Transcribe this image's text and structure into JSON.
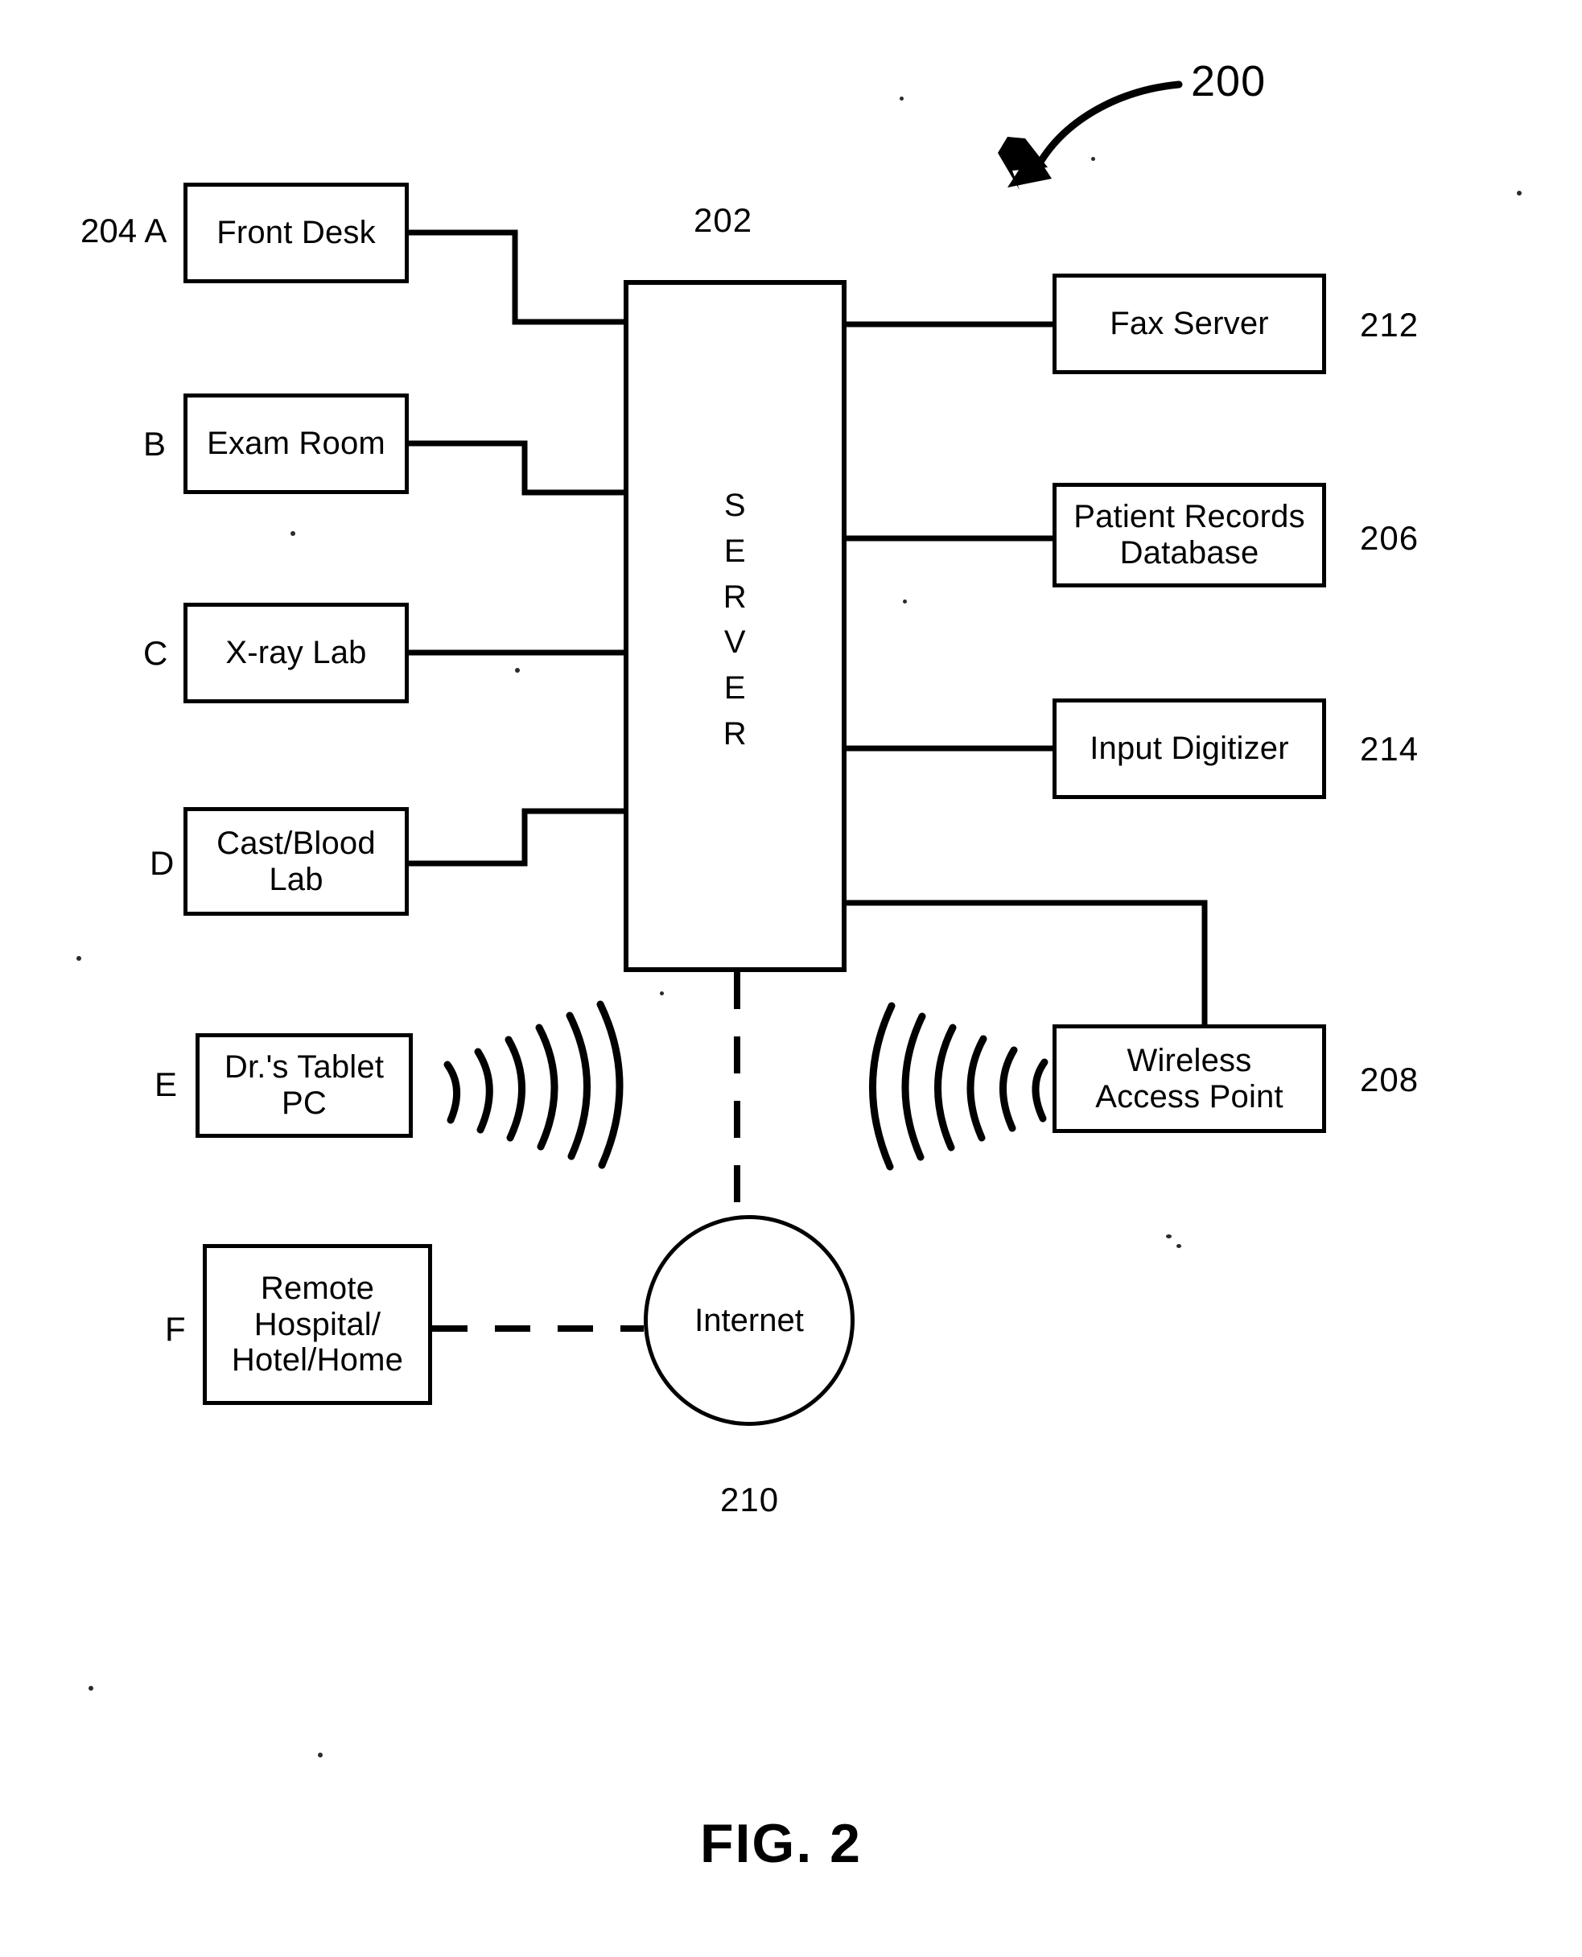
{
  "figure": {
    "caption": "FIG. 2",
    "system_ref": "200",
    "server_ref": "202",
    "server_label_letters": [
      "S",
      "E",
      "R",
      "V",
      "E",
      "R"
    ],
    "server_label_text": "SERVER"
  },
  "client_nodes": [
    {
      "letter": "204 A",
      "label": "Front Desk"
    },
    {
      "letter": "B",
      "label": "Exam Room"
    },
    {
      "letter": "C",
      "label": "X-ray Lab"
    },
    {
      "letter": "D",
      "label": "Cast/Blood\nLab",
      "line1": "Cast/Blood",
      "line2": "Lab"
    },
    {
      "letter": "E",
      "label": "Dr.'s Tablet\nPC",
      "line1": "Dr.'s Tablet",
      "line2": "PC"
    },
    {
      "letter": "F",
      "label": "Remote\nHospital/\nHotel/Home",
      "line1": "Remote",
      "line2": "Hospital/",
      "line3": "Hotel/Home"
    }
  ],
  "resource_nodes": [
    {
      "label": "Fax Server",
      "ref": "212"
    },
    {
      "label": "Patient Records\nDatabase",
      "line1": "Patient Records",
      "line2": "Database",
      "ref": "206"
    },
    {
      "label": "Input Digitizer",
      "ref": "214"
    },
    {
      "label": "Wireless\nAccess Point",
      "line1": "Wireless",
      "line2": "Access Point",
      "ref": "208"
    }
  ],
  "network_node": {
    "label": "Internet",
    "ref": "210"
  },
  "colors": {
    "ink": "#000000",
    "paper": "#ffffff"
  }
}
